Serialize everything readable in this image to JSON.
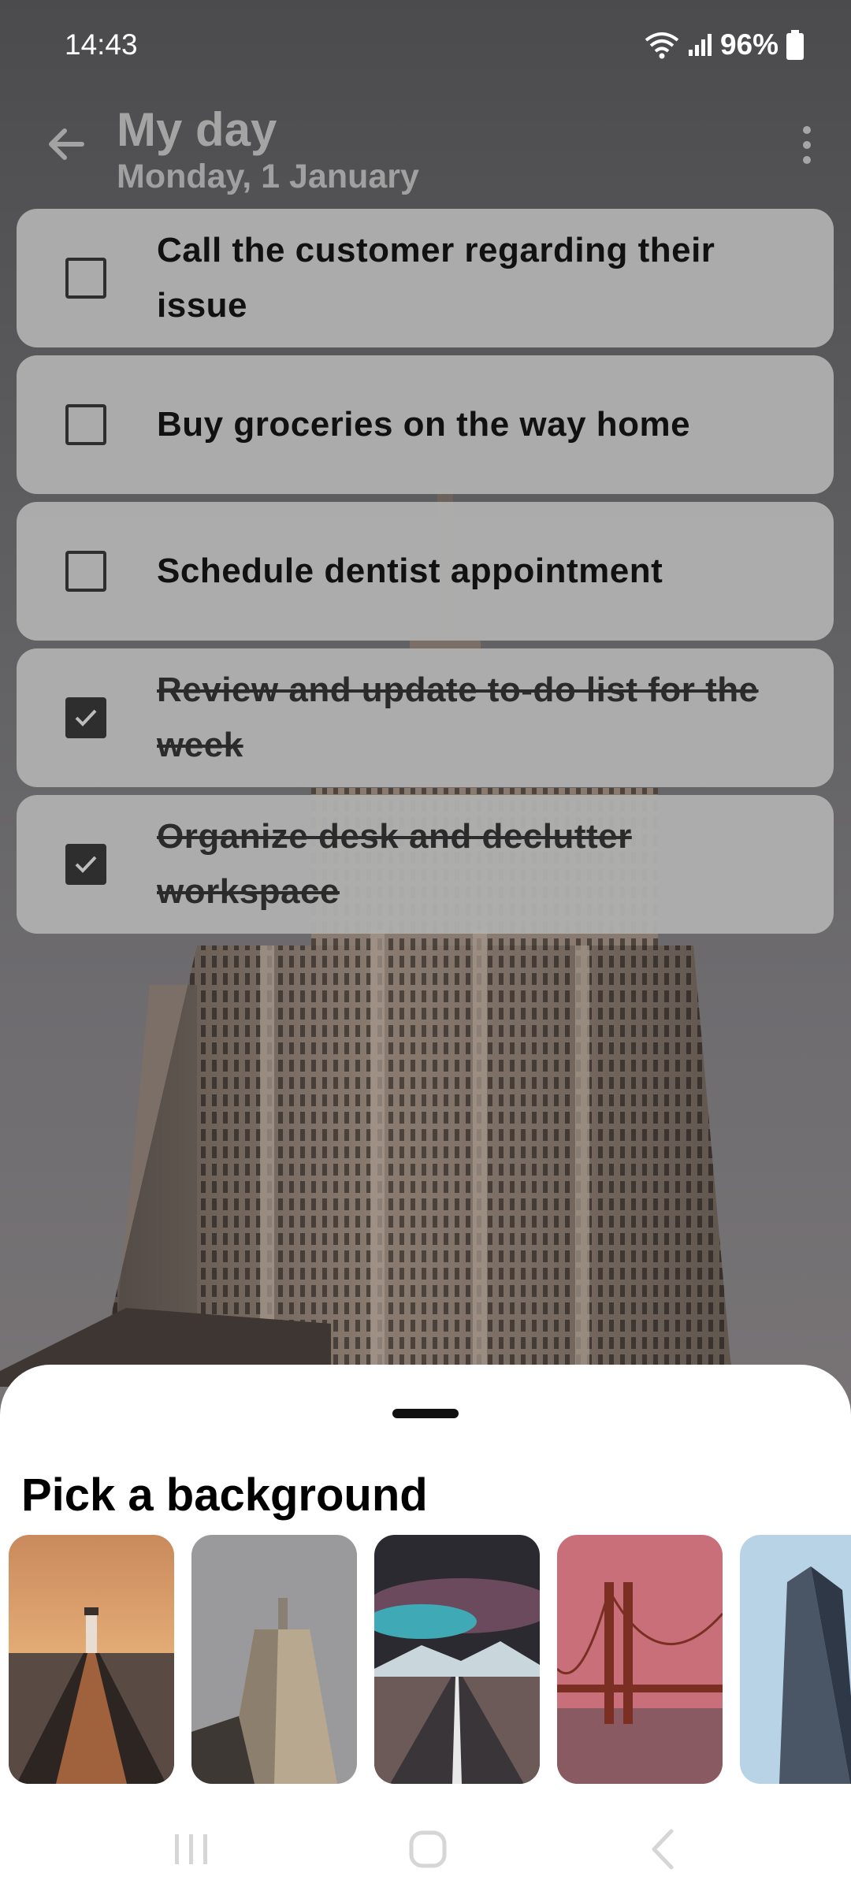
{
  "status_bar": {
    "time": "14:43",
    "battery": "96%"
  },
  "header": {
    "title": "My day",
    "subtitle": "Monday, 1 January"
  },
  "tasks": [
    {
      "text": "Call the customer regarding their issue",
      "completed": false
    },
    {
      "text": "Buy groceries on the way home",
      "completed": false
    },
    {
      "text": "Schedule dentist appointment",
      "completed": false
    },
    {
      "text": "Review and update to-do list for the week",
      "completed": true
    },
    {
      "text": "Organize desk and declutter workspace",
      "completed": true
    }
  ],
  "background_picker": {
    "title": "Pick a background",
    "options": [
      {
        "name": "lighthouse-pier"
      },
      {
        "name": "empire-state-building"
      },
      {
        "name": "mountain-road"
      },
      {
        "name": "golden-gate-bridge"
      },
      {
        "name": "flatiron-building"
      }
    ]
  }
}
